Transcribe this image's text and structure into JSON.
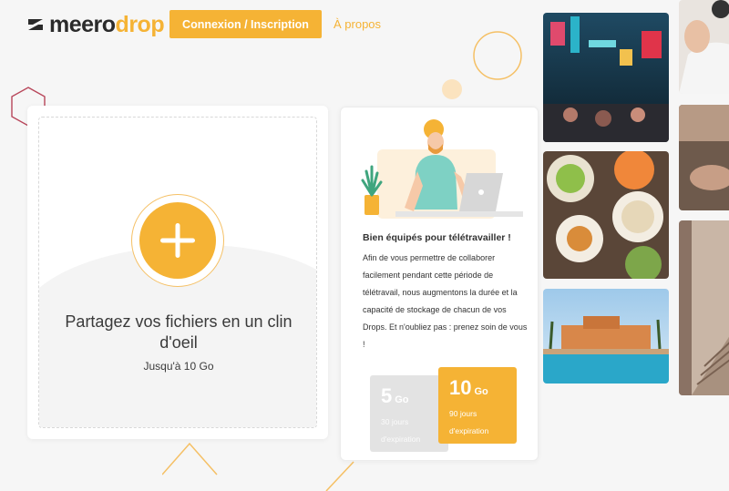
{
  "header": {
    "logo_part1": "meero",
    "logo_part2": "drop",
    "login_button": "Connexion / Inscription",
    "about_link": "À propos"
  },
  "upload": {
    "title": "Partagez vos fichiers en un clin d'oeil",
    "subtitle": "Jusqu'à 10 Go"
  },
  "info": {
    "title": "Bien équipés pour télétravailler !",
    "body": "Afin de vous permettre de collaborer facilement pendant cette période de télétravail, nous augmentons la durée et la capacité de stockage de chacun de vos Drops. Et n'oubliez pas : prenez soin de vous !"
  },
  "plans": [
    {
      "size": "5",
      "unit": "Go",
      "days": "30 jours",
      "suffix": "d'expiration"
    },
    {
      "size": "10",
      "unit": "Go",
      "days": "90 jours",
      "suffix": "d'expiration"
    }
  ],
  "icons": {
    "logo": "meero-logo-icon",
    "add": "plus-icon"
  },
  "colors": {
    "accent": "#f5b335",
    "hexagon": "#c0392b",
    "background": "#f6f6f6"
  }
}
